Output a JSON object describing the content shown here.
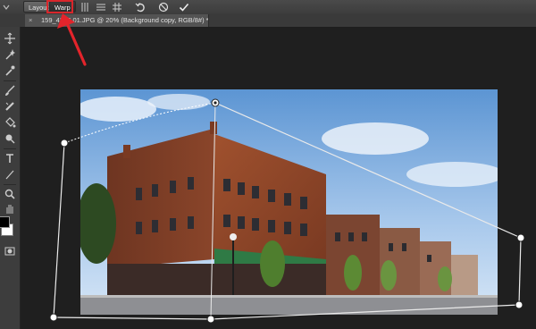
{
  "options_bar": {
    "layout_label": "Layout",
    "warp_label": "Warp",
    "icons": [
      "split-vertical-icon",
      "split-horizontal-icon",
      "grid-icon",
      "undo-icon",
      "cancel-icon",
      "commit-check-icon"
    ]
  },
  "document": {
    "tab_close": "×",
    "tab_title": "159_4316 01.JPG @ 20% (Background copy, RGB/8#) *"
  },
  "tools": [
    "move-icon",
    "magic-wand-icon",
    "eyedropper-icon",
    "brush-icon",
    "healing-brush-icon",
    "paint-bucket-icon",
    "dodge-icon",
    "type-icon",
    "path-selection-icon",
    "zoom-icon",
    "hand-icon"
  ],
  "colors": {
    "highlight": "#d9262b",
    "annotation_arrow": "#e3242b",
    "swatch_foreground": "#000000",
    "swatch_background": "#ffffff"
  }
}
